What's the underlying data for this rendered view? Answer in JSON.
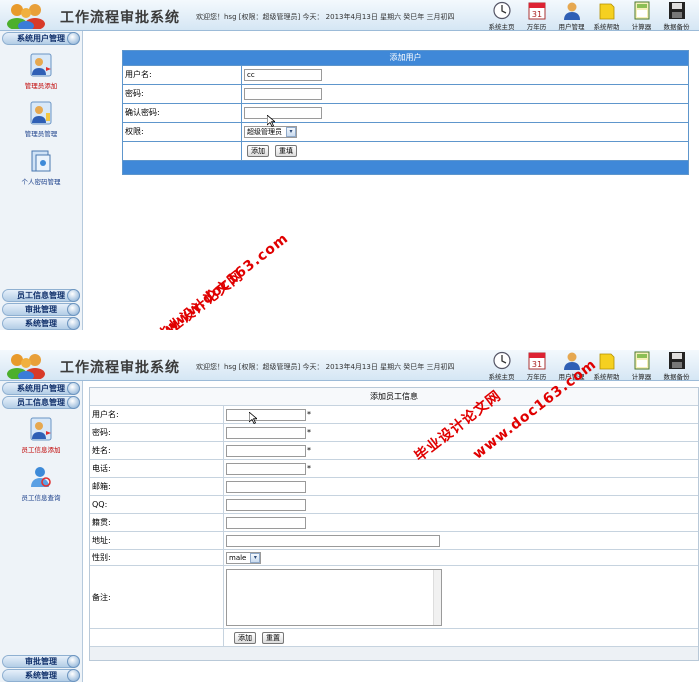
{
  "app": {
    "title": "工作流程审批系统",
    "welcome": "欢迎您！hsg [权限：超级管理员] 今天： 2013年4月13日 星期六 癸巳年 三月初四"
  },
  "toolbar": [
    {
      "label": "系统主页",
      "icon": "clock-icon"
    },
    {
      "label": "万年历",
      "icon": "calendar-icon"
    },
    {
      "label": "用户管理",
      "icon": "user-icon"
    },
    {
      "label": "系统帮助",
      "icon": "help-book-icon"
    },
    {
      "label": "计算器",
      "icon": "calculator-icon"
    },
    {
      "label": "数据备份",
      "icon": "floppy-disk-icon"
    }
  ],
  "screen1": {
    "sidebar": {
      "top_section": "系统用户管理",
      "items": [
        {
          "label": "管理员添加",
          "icon": "admin-add-icon"
        },
        {
          "label": "管理员管理",
          "icon": "admin-manage-icon"
        },
        {
          "label": "个人密码管理",
          "icon": "password-icon"
        }
      ],
      "bottom_sections": [
        "员工信息管理",
        "审批管理",
        "系统管理"
      ]
    },
    "form": {
      "title": "添加用户",
      "username_label": "用户名:",
      "username_value": "cc",
      "password_label": "密码:",
      "confirm_label": "确认密码:",
      "role_label": "权限:",
      "role_value": "超级管理员",
      "submit": "添加",
      "reset": "重填"
    }
  },
  "screen2": {
    "sidebar": {
      "top_sections": [
        "系统用户管理",
        "员工信息管理"
      ],
      "items": [
        {
          "label": "员工信息添加",
          "icon": "staff-add-icon"
        },
        {
          "label": "员工信息查询",
          "icon": "staff-search-icon"
        }
      ],
      "bottom_sections": [
        "审批管理",
        "系统管理"
      ]
    },
    "form": {
      "title": "添加员工信息",
      "username_label": "用户名:",
      "password_label": "密码:",
      "name_label": "姓名:",
      "phone_label": "电话:",
      "email_label": "邮箱:",
      "qq_label": "QQ:",
      "hometown_label": "籍贯:",
      "address_label": "地址:",
      "gender_label": "性别:",
      "gender_value": "male",
      "note_label": "备注:",
      "required_mark": "*",
      "submit": "添加",
      "reset": "重置"
    }
  },
  "watermark": {
    "url": "www.doc163.com",
    "name": "毕业设计论文网"
  }
}
